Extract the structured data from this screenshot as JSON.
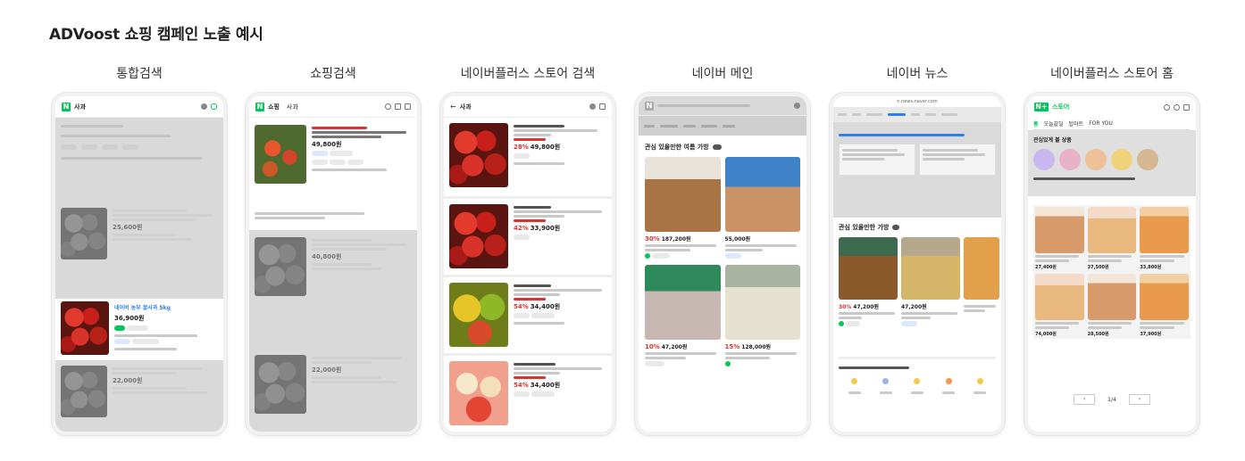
{
  "page": {
    "title": "ADVoost 쇼핑 캠페인 노출 예시"
  },
  "columns": [
    {
      "id": "integrated-search",
      "label": "통합검색"
    },
    {
      "id": "shopping-search",
      "label": "쇼핑검색"
    },
    {
      "id": "naverplus-store-search",
      "label": "네이버플러스 스토어 검색"
    },
    {
      "id": "naver-main",
      "label": "네이버 메인"
    },
    {
      "id": "naver-news",
      "label": "네이버 뉴스"
    },
    {
      "id": "naverplus-store-home",
      "label": "네이버플러스 스토어 홈"
    }
  ],
  "screens": {
    "integrated": {
      "query": "사과",
      "highlight_title": "네이버 농부 꿀사과 5kg",
      "highlight_price": "36,900원",
      "price_1": "25,600원",
      "price_3": "22,000원"
    },
    "shopping": {
      "logo_text": "쇼핑",
      "query": "사과",
      "highlight_price": "49,800원",
      "price_2": "40,800원",
      "price_3": "22,000원"
    },
    "store_search": {
      "query": "사과",
      "items": [
        {
          "discount": "28%",
          "price": "49,800원"
        },
        {
          "discount": "42%",
          "price": "33,900원"
        },
        {
          "discount": "54%",
          "price": "34,400원"
        },
        {
          "discount": "54%",
          "price": "34,400원"
        }
      ]
    },
    "main": {
      "section_title": "관심 있을만한 여름 가방",
      "items": [
        {
          "discount": "30%",
          "price": "187,200원"
        },
        {
          "discount": "",
          "price": "55,000원"
        },
        {
          "discount": "10%",
          "price": "47,200원"
        },
        {
          "discount": "15%",
          "price": "128,000원"
        }
      ]
    },
    "news": {
      "url": "n.news.naver.com",
      "section_title": "관심 있을만한 가방",
      "price_1": "47,200원",
      "price_2": "47,200원"
    },
    "store_home": {
      "logo_text": "스토어",
      "tabs": [
        "홈",
        "오늘끝딜",
        "탑마트",
        "FOR YOU"
      ],
      "section_title": "관심있게 볼 상품",
      "page_indicator": "1/4",
      "prices": [
        "27,400원",
        "37,500원",
        "33,800원",
        "74,000원",
        "28,500원",
        "37,900원"
      ]
    }
  },
  "colors": {
    "naver_green": "#03c75a",
    "sale_red": "#e0302f"
  }
}
